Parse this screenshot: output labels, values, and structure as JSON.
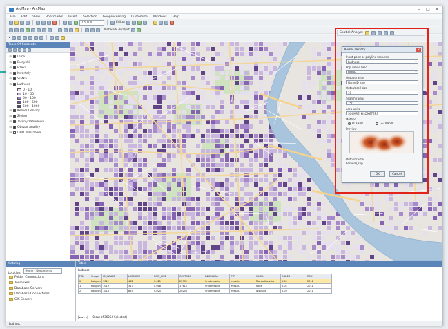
{
  "window": {
    "title": "ArcMap - ArcMap"
  },
  "menubar": [
    "File",
    "Edit",
    "View",
    "Bookmarks",
    "Insert",
    "Selection",
    "Geoprocessing",
    "Customize",
    "Windows",
    "Help"
  ],
  "toolbar": {
    "editor_label": "Editor",
    "network_analyst_label": "Network Analyst",
    "scale_value": "1:5,000",
    "spatial_analyst_label": "Spatial Analyst"
  },
  "toc": {
    "title": "Table Of Contents",
    "layers": [
      {
        "label": "Ulice",
        "checked": true
      },
      {
        "label": "Budynki",
        "checked": true
      },
      {
        "label": "Rzeki",
        "checked": true
      },
      {
        "label": "Kwartaly",
        "checked": true
      },
      {
        "label": "Siatka",
        "checked": true
      },
      {
        "label": "Ludnosc",
        "checked": true
      },
      {
        "label": "Kernel Density",
        "checked": true
      },
      {
        "label": "Zielen",
        "checked": true
      },
      {
        "label": "Tereny zabudowy",
        "checked": true
      },
      {
        "label": "Obszar analizy",
        "checked": true
      },
      {
        "label": "DEM Warszawa",
        "checked": false
      }
    ],
    "legend": [
      {
        "label": "0 - 10",
        "color": "#e6dff0"
      },
      {
        "label": "10 - 50",
        "color": "#c5b1df"
      },
      {
        "label": "50 - 100",
        "color": "#9e7fc8"
      },
      {
        "label": "100 - 500",
        "color": "#7b54ad"
      },
      {
        "label": "500 - 1000",
        "color": "#52317e"
      }
    ]
  },
  "dialog_toolbar": {
    "label": "Spatial Analyst"
  },
  "dialog": {
    "title": "Kernel Density",
    "input_label": "Input point or polyline features",
    "input_value": "Ludnosc",
    "population_label": "Population field",
    "population_value": "NONE",
    "output_label": "Output raster",
    "output_value": "KernelD_shp",
    "cell_label": "Output cell size",
    "cell_value": "10",
    "radius_label": "Search radius",
    "radius_value": "150",
    "area_label": "Area units",
    "area_value": "SQUARE_KILOMETERS",
    "method_label": "Method",
    "radio_options": [
      {
        "label": "PLANAR",
        "selected": true
      },
      {
        "label": "GEODESIC",
        "selected": false
      }
    ],
    "preview_label": "Preview",
    "ok_label": "OK",
    "cancel_label": "Cancel"
  },
  "catalog": {
    "title": "Catalog",
    "location_label": "Location:",
    "location_value": "Home - Documents",
    "items": [
      "Folder Connections",
      "Toolboxes",
      "Database Servers",
      "Database Connections",
      "GIS Servers"
    ]
  },
  "attribute_table": {
    "title": "Table",
    "layer_name": "Ludnosc",
    "columns": [
      "FID",
      "Shape",
      "ID_KWART",
      "LUDNOSC",
      "POW_KM2",
      "GESTOSC",
      "DZIELNICA",
      "TYP",
      "ULICA",
      "OBREB",
      "ROK"
    ],
    "rows": [
      [
        "0",
        "Polygon",
        "1012",
        "482",
        "0.021",
        "22952",
        "Srodmiescie",
        "mieszk.",
        "Marszalkowska",
        "5-01",
        "2011"
      ],
      [
        "1",
        "Polygon",
        "1013",
        "317",
        "0.018",
        "17611",
        "Srodmiescie",
        "mieszk.",
        "Hoza",
        "5-01",
        "2011"
      ],
      [
        "2",
        "Polygon",
        "1014",
        "655",
        "0.025",
        "26200",
        "Srodmiescie",
        "mieszk.",
        "Wspolna",
        "5-02",
        "2011"
      ]
    ],
    "status": "(0 out of 36254 Selected)",
    "record_label": "Ludnosc"
  }
}
